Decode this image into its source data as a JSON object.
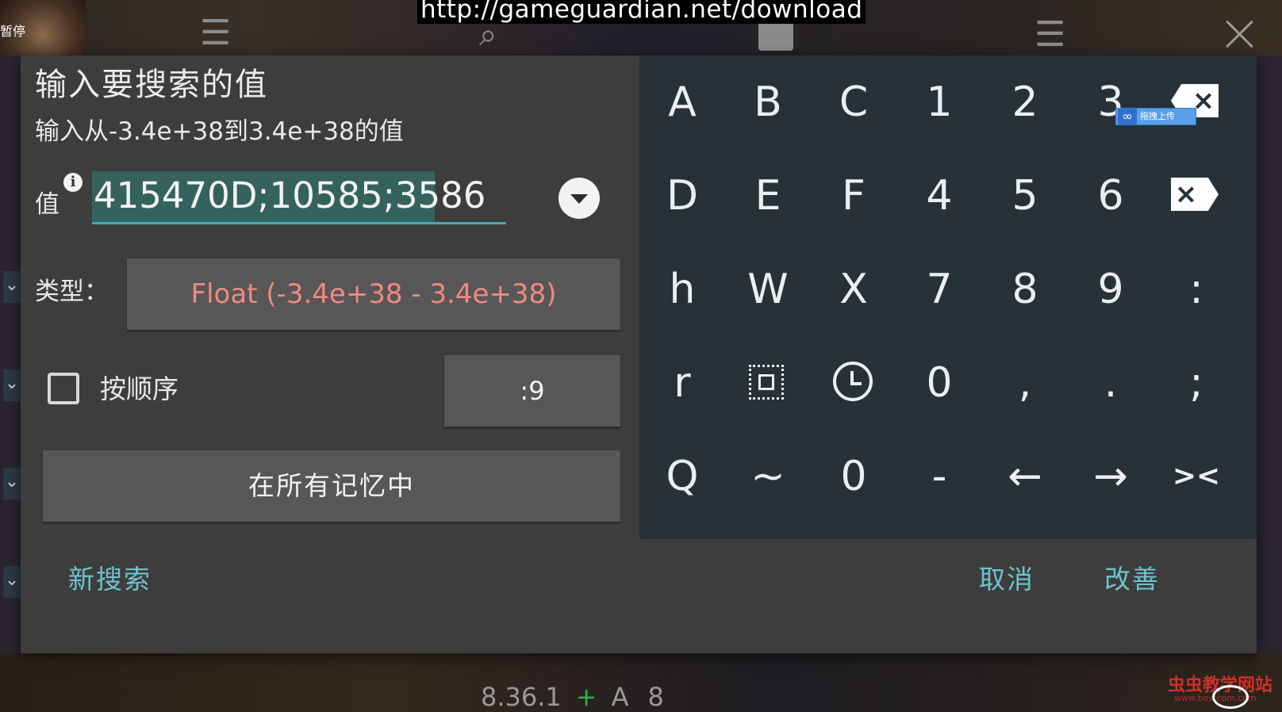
{
  "background": {
    "pause_text": "暂停",
    "url_banner": "http://gameguardian.net/download",
    "status_bar": {
      "version": "8.36.1",
      "plus": "+",
      "letter": "A",
      "count": "8"
    },
    "watermark": "虫虫教学网站",
    "watermark_sub": "www.bestcom.com",
    "icons": [
      "sliders-icon",
      "search-icon",
      "save-icon",
      "list-icon",
      "close-icon"
    ]
  },
  "dialog": {
    "title": "输入要搜索的值",
    "subtitle": "输入从-3.4e+38到3.4e+38的值",
    "value_label": "值",
    "value": "415470D;10585;3586",
    "type_label": "类型：",
    "type_value": "Float (-3.4e+38 - 3.4e+38)",
    "order_label": "按顺序",
    "order_checked": false,
    "order_value": ":9",
    "memory_button": "在所有记忆中",
    "new_search": "新搜索",
    "cancel": "取消",
    "refine": "改善"
  },
  "keypad": {
    "rows": [
      [
        "A",
        "B",
        "C",
        "1",
        "2",
        "3"
      ],
      [
        "D",
        "E",
        "F",
        "4",
        "5",
        "6"
      ],
      [
        "h",
        "W",
        "X",
        "7",
        "8",
        "9",
        ":"
      ],
      [
        "r",
        "",
        "",
        "0",
        ",",
        ".",
        ";"
      ],
      [
        "Q",
        "~",
        "0",
        "-",
        "←",
        "→",
        "><"
      ]
    ],
    "upload_badge": "拖拽上传",
    "colors": {
      "keypad_bg": "#263238",
      "accent": "#6ec3cc",
      "type_text": "#f08a7e"
    }
  }
}
